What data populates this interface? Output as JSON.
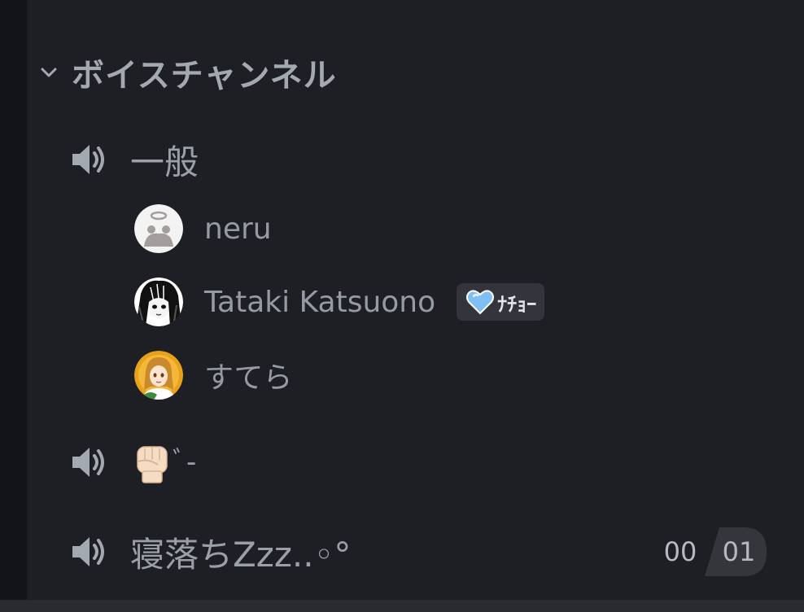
{
  "category": {
    "label": "ボイスチャンネル",
    "icon": "chevron-down-icon"
  },
  "channels": [
    {
      "name": "一般",
      "icon": "speaker-icon",
      "members": [
        {
          "name": "neru",
          "avatar": "default-avatar"
        },
        {
          "name": "Tataki Katsuono",
          "avatar": "anime-avatar-bw",
          "tag": {
            "label": "ﾅﾁｮｰ",
            "icon": "blue-heart-icon"
          }
        },
        {
          "name": "すてら",
          "avatar": "anime-avatar-color"
        }
      ]
    },
    {
      "name_emoji": "raised-fist-emoji",
      "name_suffix": "ﾞ-",
      "icon": "speaker-icon"
    },
    {
      "name": "寝落ちZzz..◦°",
      "icon": "speaker-icon",
      "user_count": "00",
      "user_limit": "01"
    }
  ],
  "colors": {
    "background": "#1e1f24",
    "text_muted": "#949ba4",
    "tag_bg": "#34353c",
    "heart": "#8fc9ff"
  }
}
